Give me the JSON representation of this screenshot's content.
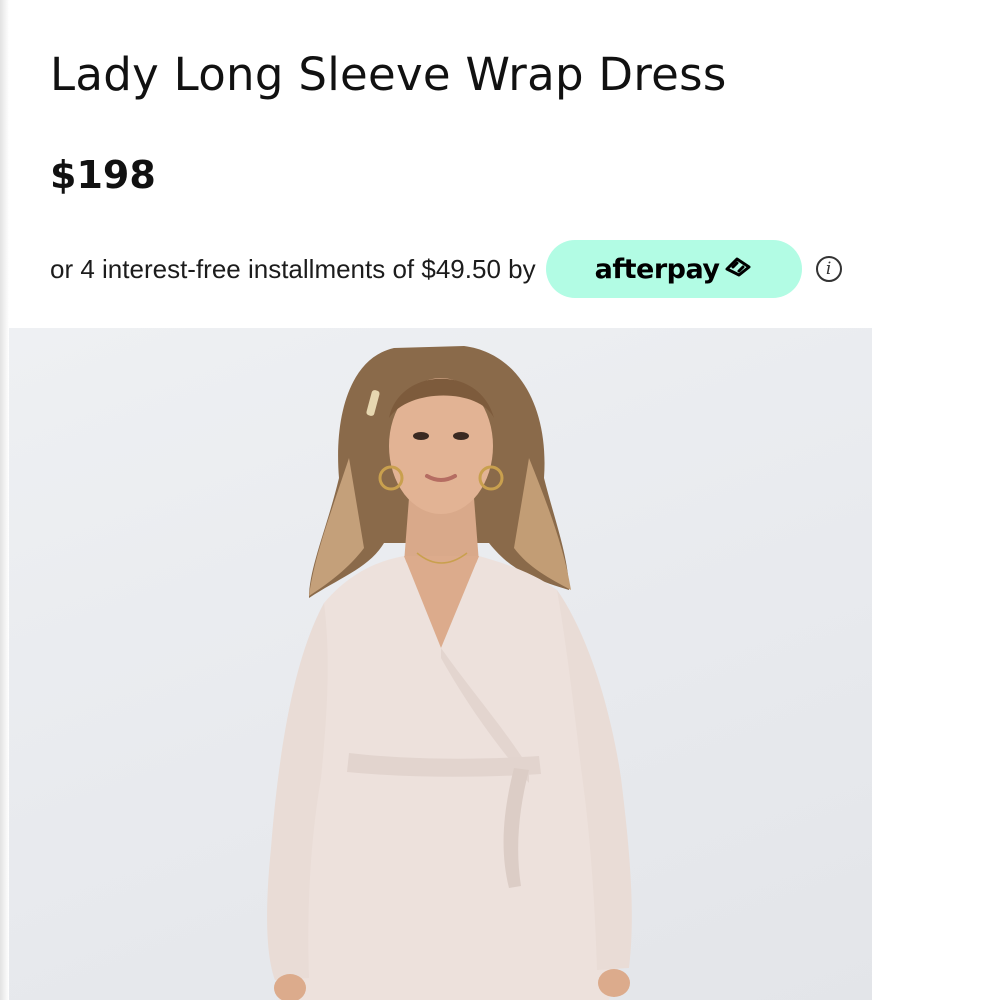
{
  "product": {
    "title": "Lady Long Sleeve Wrap Dress",
    "price": "$198"
  },
  "afterpay": {
    "installment_text": "or 4 interest-free installments of $49.50 by",
    "brand_label": "afterpay",
    "badge_color": "#b2fce4",
    "info_icon": "info-circle-icon"
  },
  "image": {
    "subject": "model-wearing-dress",
    "dress_color": "#ece0dc",
    "background_color": "#e8eaee"
  }
}
